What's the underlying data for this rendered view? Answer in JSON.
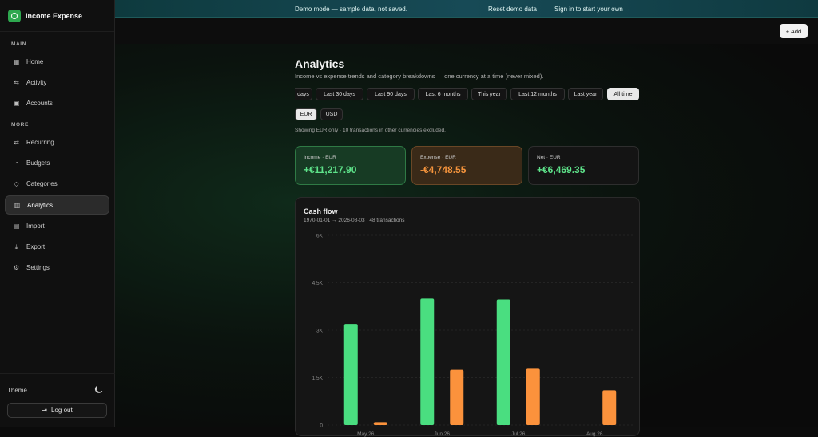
{
  "app": {
    "name": "Income Expense"
  },
  "banner": {
    "message": "Demo mode — sample data, not saved.",
    "reset": "Reset demo data",
    "signin": "Sign in to start your own →"
  },
  "sidebar": {
    "main_label": "MAIN",
    "more_label": "MORE",
    "items": [
      {
        "label": "Home",
        "icon": "grid-icon"
      },
      {
        "label": "Activity",
        "icon": "arrows-icon"
      },
      {
        "label": "Accounts",
        "icon": "wallet-icon"
      },
      {
        "label": "Recurring",
        "icon": "repeat-icon"
      },
      {
        "label": "Budgets",
        "icon": "piggy-icon"
      },
      {
        "label": "Categories",
        "icon": "tag-icon"
      },
      {
        "label": "Analytics",
        "icon": "chart-icon",
        "active": true
      },
      {
        "label": "Import",
        "icon": "file-import-icon"
      },
      {
        "label": "Export",
        "icon": "download-icon"
      },
      {
        "label": "Settings",
        "icon": "gear-icon"
      }
    ],
    "theme_label": "Theme",
    "logout_label": "Log out"
  },
  "toolbar": {
    "add_label": "+ Add"
  },
  "page": {
    "title": "Analytics",
    "subtitle": "Income vs expense trends and category breakdowns — one currency at a time (never mixed).",
    "ranges": [
      "days",
      "Last 30 days",
      "Last 90 days",
      "Last 6 months",
      "This year",
      "Last 12 months",
      "Last year",
      "All time"
    ],
    "selected_range": "All time",
    "currencies": [
      "EUR",
      "USD"
    ],
    "selected_currency": "EUR",
    "note": "Showing EUR only · 10 transactions in other currencies excluded."
  },
  "summary": {
    "income": {
      "label": "Income · EUR",
      "value": "+€11,217.90"
    },
    "expense": {
      "label": "Expense · EUR",
      "value": "-€4,748.55"
    },
    "net": {
      "label": "Net · EUR",
      "value": "+€6,469.35"
    }
  },
  "colors": {
    "income": "#4ade80",
    "expense": "#fb923c",
    "accent": "#2ea84f"
  },
  "chart_data": {
    "type": "bar",
    "title": "Cash flow",
    "subtitle": "1970-01-01 → 2026-08-03 · 48 transactions",
    "categories": [
      "May 26",
      "Jun 26",
      "Jul 26",
      "Aug 26"
    ],
    "series": [
      {
        "name": "Income",
        "values": [
          3200,
          4000,
          3970,
          0
        ]
      },
      {
        "name": "Expense",
        "values": [
          90,
          1750,
          1780,
          1100
        ]
      }
    ],
    "yticks": [
      "0",
      "1.5K",
      "3K",
      "4.5K",
      "6K"
    ],
    "ylim": [
      0,
      6000
    ],
    "grid": true
  }
}
